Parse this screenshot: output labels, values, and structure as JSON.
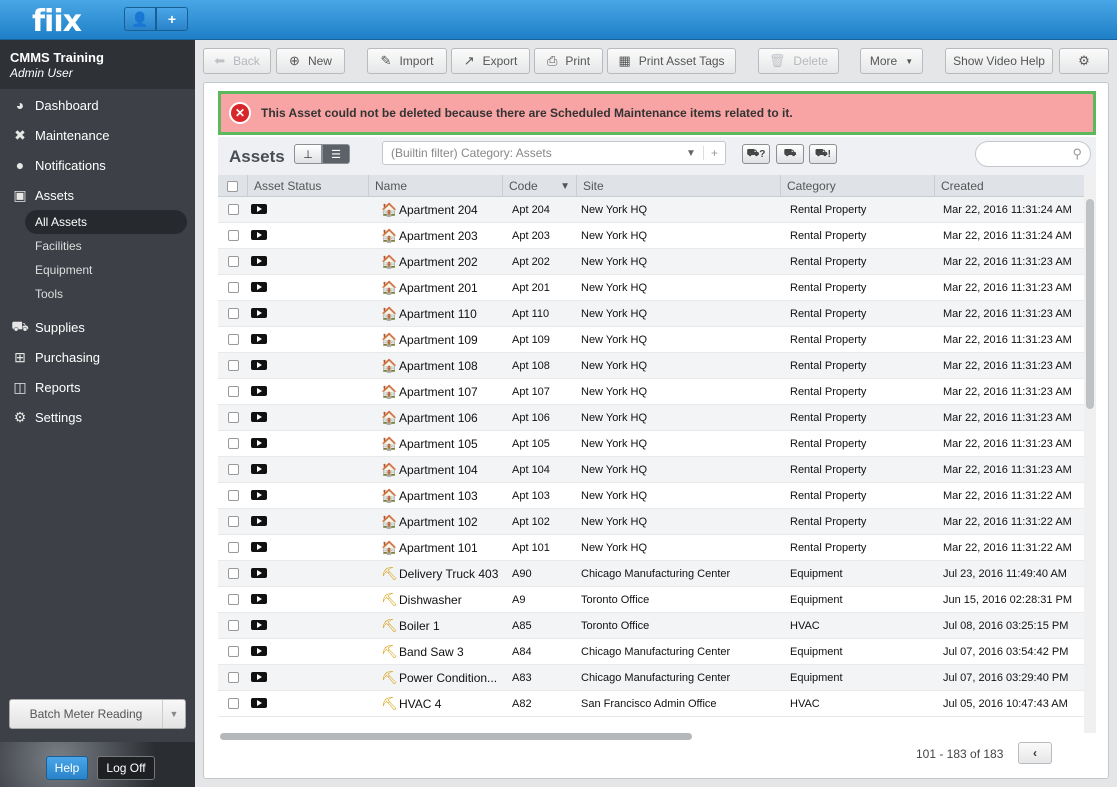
{
  "app": {
    "logo": "fiix",
    "user_icon": "user-icon",
    "add_icon": "plus-icon"
  },
  "org": {
    "name": "CMMS Training",
    "role": "Admin User"
  },
  "nav": [
    {
      "label": "Dashboard",
      "icon": "dashboard-icon",
      "glyph": "◕"
    },
    {
      "label": "Maintenance",
      "icon": "wrench-icon",
      "glyph": "✖"
    },
    {
      "label": "Notifications",
      "icon": "chat-icon",
      "glyph": "●"
    },
    {
      "label": "Assets",
      "icon": "box-icon",
      "glyph": "▣"
    }
  ],
  "asset_sub": [
    "All Assets",
    "Facilities",
    "Equipment",
    "Tools"
  ],
  "nav2": [
    {
      "label": "Supplies",
      "icon": "truck-icon",
      "glyph": "⛟"
    },
    {
      "label": "Purchasing",
      "icon": "cart-icon",
      "glyph": "⊞"
    },
    {
      "label": "Reports",
      "icon": "chart-icon",
      "glyph": "◫"
    },
    {
      "label": "Settings",
      "icon": "gear-icon",
      "glyph": "⚙"
    }
  ],
  "batch": {
    "label": "Batch Meter Reading"
  },
  "footer": {
    "help": "Help",
    "logoff": "Log Off"
  },
  "toolbar": {
    "back": "Back",
    "new": "New",
    "import": "Import",
    "export": "Export",
    "print": "Print",
    "print_tags": "Print Asset Tags",
    "delete": "Delete",
    "more": "More",
    "video_help": "Show Video Help"
  },
  "alert": {
    "message": "This Asset could not be deleted because there are Scheduled Maintenance items related to it."
  },
  "grid": {
    "title": "Assets",
    "filter": "(Builtin filter) Category: Assets",
    "truck_buttons": [
      "?",
      "",
      "!"
    ],
    "columns": [
      "Asset Status",
      "Name",
      "Code",
      "Site",
      "Category",
      "Created"
    ]
  },
  "rows": [
    {
      "name": "Apartment 204",
      "type": "prop",
      "code": "Apt 204",
      "site": "New York HQ",
      "category": "Rental Property",
      "created": "Mar 22, 2016 11:31:24 AM"
    },
    {
      "name": "Apartment 203",
      "type": "prop",
      "code": "Apt 203",
      "site": "New York HQ",
      "category": "Rental Property",
      "created": "Mar 22, 2016 11:31:24 AM"
    },
    {
      "name": "Apartment 202",
      "type": "prop",
      "code": "Apt 202",
      "site": "New York HQ",
      "category": "Rental Property",
      "created": "Mar 22, 2016 11:31:23 AM"
    },
    {
      "name": "Apartment 201",
      "type": "prop",
      "code": "Apt 201",
      "site": "New York HQ",
      "category": "Rental Property",
      "created": "Mar 22, 2016 11:31:23 AM"
    },
    {
      "name": "Apartment 110",
      "type": "prop",
      "code": "Apt 110",
      "site": "New York HQ",
      "category": "Rental Property",
      "created": "Mar 22, 2016 11:31:23 AM"
    },
    {
      "name": "Apartment 109",
      "type": "prop",
      "code": "Apt 109",
      "site": "New York HQ",
      "category": "Rental Property",
      "created": "Mar 22, 2016 11:31:23 AM"
    },
    {
      "name": "Apartment 108",
      "type": "prop",
      "code": "Apt 108",
      "site": "New York HQ",
      "category": "Rental Property",
      "created": "Mar 22, 2016 11:31:23 AM"
    },
    {
      "name": "Apartment 107",
      "type": "prop",
      "code": "Apt 107",
      "site": "New York HQ",
      "category": "Rental Property",
      "created": "Mar 22, 2016 11:31:23 AM"
    },
    {
      "name": "Apartment 106",
      "type": "prop",
      "code": "Apt 106",
      "site": "New York HQ",
      "category": "Rental Property",
      "created": "Mar 22, 2016 11:31:23 AM"
    },
    {
      "name": "Apartment 105",
      "type": "prop",
      "code": "Apt 105",
      "site": "New York HQ",
      "category": "Rental Property",
      "created": "Mar 22, 2016 11:31:23 AM"
    },
    {
      "name": "Apartment 104",
      "type": "prop",
      "code": "Apt 104",
      "site": "New York HQ",
      "category": "Rental Property",
      "created": "Mar 22, 2016 11:31:23 AM"
    },
    {
      "name": "Apartment 103",
      "type": "prop",
      "code": "Apt 103",
      "site": "New York HQ",
      "category": "Rental Property",
      "created": "Mar 22, 2016 11:31:22 AM"
    },
    {
      "name": "Apartment 102",
      "type": "prop",
      "code": "Apt 102",
      "site": "New York HQ",
      "category": "Rental Property",
      "created": "Mar 22, 2016 11:31:22 AM"
    },
    {
      "name": "Apartment 101",
      "type": "prop",
      "code": "Apt 101",
      "site": "New York HQ",
      "category": "Rental Property",
      "created": "Mar 22, 2016 11:31:22 AM"
    },
    {
      "name": "Delivery Truck 403",
      "type": "equip",
      "code": "A90",
      "site": "Chicago Manufacturing Center",
      "category": "Equipment",
      "created": "Jul 23, 2016 11:49:40 AM"
    },
    {
      "name": "Dishwasher",
      "type": "equip",
      "code": "A9",
      "site": "Toronto Office",
      "category": "Equipment",
      "created": "Jun 15, 2016 02:28:31 PM"
    },
    {
      "name": "Boiler 1",
      "type": "equip",
      "code": "A85",
      "site": "Toronto Office",
      "category": "HVAC",
      "created": "Jul 08, 2016 03:25:15 PM"
    },
    {
      "name": "Band Saw 3",
      "type": "equip",
      "code": "A84",
      "site": "Chicago Manufacturing Center",
      "category": "Equipment",
      "created": "Jul 07, 2016 03:54:42 PM"
    },
    {
      "name": "Power Condition...",
      "type": "equip",
      "code": "A83",
      "site": "Chicago Manufacturing Center",
      "category": "Equipment",
      "created": "Jul 07, 2016 03:29:40 PM"
    },
    {
      "name": "HVAC 4",
      "type": "equip",
      "code": "A82",
      "site": "San Francisco Admin Office",
      "category": "HVAC",
      "created": "Jul 05, 2016 10:47:43 AM"
    }
  ],
  "pager": {
    "range": "101 - 183 of 183",
    "prev": "‹"
  }
}
